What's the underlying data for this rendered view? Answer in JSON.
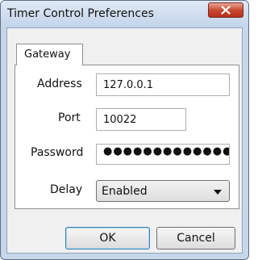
{
  "window": {
    "title": "Timer Control Preferences",
    "close_icon": "close-icon",
    "close_color": "#c7472f"
  },
  "tabs": [
    {
      "label": "Gateway",
      "selected": true
    }
  ],
  "form": {
    "address": {
      "label": "Address",
      "value": "127.0.0.1"
    },
    "port": {
      "label": "Port",
      "value": "10022"
    },
    "password": {
      "label": "Password",
      "value": "●●●●●●●●●●●●●●●●"
    },
    "delay": {
      "label": "Delay",
      "selected": "Enabled",
      "icon": "chevron-down-icon"
    }
  },
  "buttons": {
    "ok": "OK",
    "cancel": "Cancel"
  }
}
